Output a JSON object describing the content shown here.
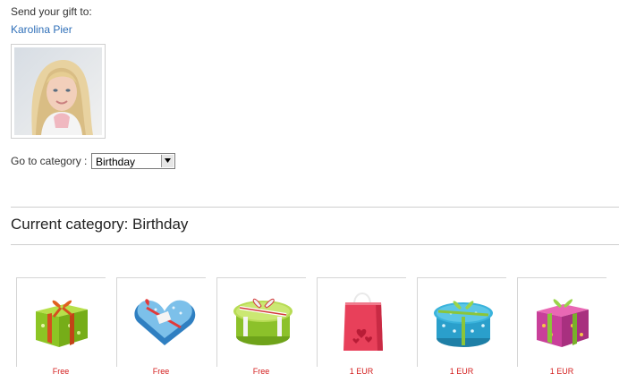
{
  "header": {
    "send_label": "Send your gift to:",
    "recipient_name": "Karolina Pier"
  },
  "category_select": {
    "label": "Go to category :",
    "selected": "Birthday"
  },
  "current_category": {
    "title": "Current category: Birthday"
  },
  "gifts": [
    {
      "name": "green-gift-box",
      "price": "Free"
    },
    {
      "name": "heart-gift-box",
      "price": "Free"
    },
    {
      "name": "round-green-gift-box",
      "price": "Free"
    },
    {
      "name": "pink-gift-bag",
      "price": "1 EUR"
    },
    {
      "name": "blue-round-gift-box",
      "price": "1 EUR"
    },
    {
      "name": "pink-gift-box",
      "price": "1 EUR"
    }
  ],
  "colors": {
    "link": "#2f6fb8",
    "price": "#d42020",
    "rule": "#cfcfcf"
  }
}
